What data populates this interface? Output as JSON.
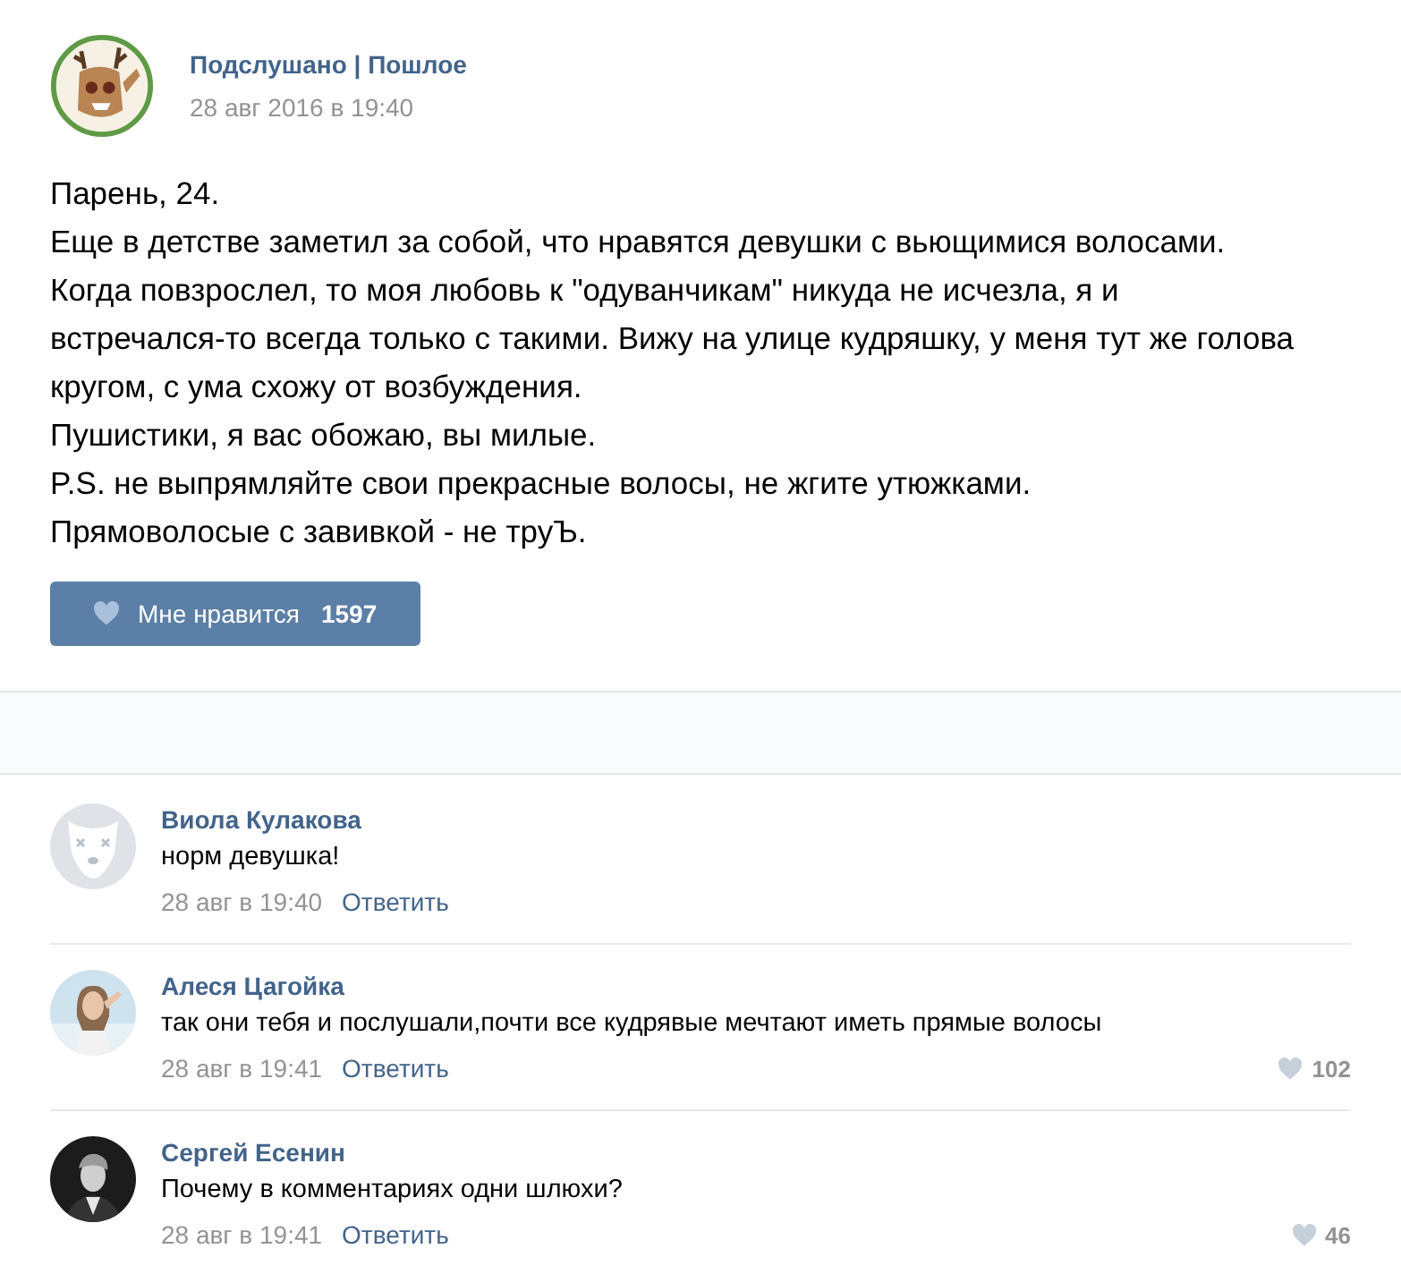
{
  "post": {
    "author": "Подслушано | Пошлое",
    "date": "28 авг 2016 в 19:40",
    "paragraphs": [
      "Парень, 24.",
      "Еще в детстве заметил за собой, что нравятся девушки с вьющимися волосами.",
      "Когда повзрослел, то моя любовь к \"одуванчикам\" никуда не исчезла, я и встречался-то всегда только с такими. Вижу на улице кудряшку, у меня тут же голова кругом, с ума схожу от возбуждения.",
      "Пушистики, я вас обожаю, вы милые.",
      "P.S. не выпрямляйте свои прекрасные волосы, не жгите утюжками.",
      "Прямоволосые с завивкой - не труЪ."
    ],
    "like_button": {
      "label": "Мне нравится",
      "count": "1597"
    }
  },
  "comments": [
    {
      "kind": "default",
      "author": "Виола Кулакова",
      "text": "норм девушка!",
      "date": "28 авг в 19:40",
      "reply": "Ответить"
    },
    {
      "author": "Алеся Цагойка",
      "text": "так они тебя и послушали,почти все кудрявые мечтают иметь прямые волосы",
      "date": "28 авг в 19:41",
      "reply": "Ответить",
      "likes": "102"
    },
    {
      "kind": "photo_dark",
      "author": "Сергей Есенин",
      "text": "Почему в комментариях одни шлюхи?",
      "date": "28 авг в 19:41",
      "reply": "Ответить",
      "likes": "46"
    }
  ]
}
